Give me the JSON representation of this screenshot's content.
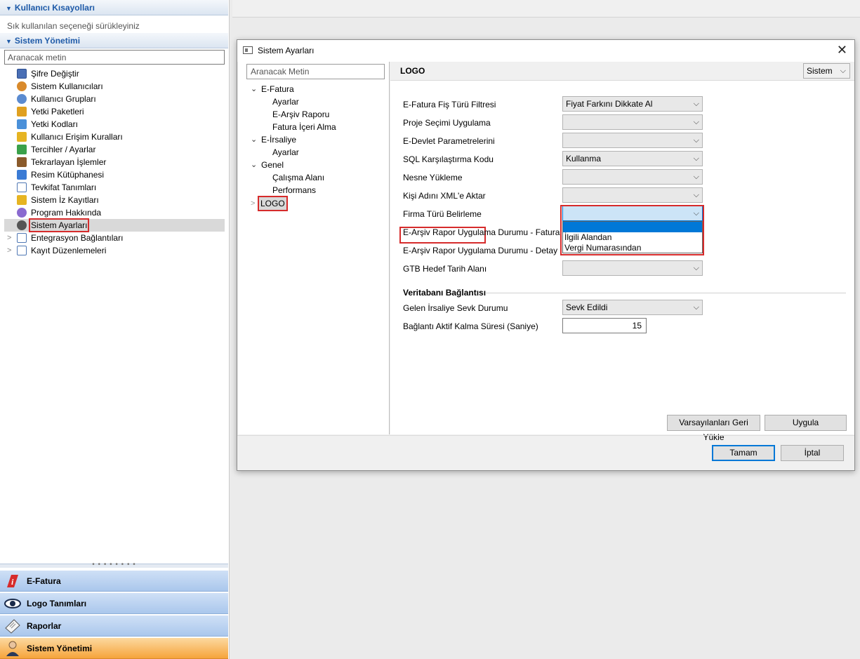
{
  "left_panel": {
    "shortcuts_header": "Kullanıcı Kısayolları",
    "shortcuts_hint": "Sık kullanılan seçeneği sürükleyiniz",
    "system_header": "Sistem Yönetimi",
    "search_placeholder": "Aranacak metin",
    "items": [
      {
        "label": "Şifre Değiştir",
        "icon": "password-icon",
        "color": "#4a6fb5"
      },
      {
        "label": "Sistem Kullanıcıları",
        "icon": "users-icon",
        "color": "#d98a2b"
      },
      {
        "label": "Kullanıcı Grupları",
        "icon": "user-groups-icon",
        "color": "#5b8bd0"
      },
      {
        "label": "Yetki Paketleri",
        "icon": "key-icon",
        "color": "#e0a020"
      },
      {
        "label": "Yetki Kodları",
        "icon": "key-icon",
        "color": "#4a90d9"
      },
      {
        "label": "Kullanıcı Erişim Kuralları",
        "icon": "lock-icon",
        "color": "#e6b422"
      },
      {
        "label": "Tercihler / Ayarlar",
        "icon": "preferences-icon",
        "color": "#3aa14a"
      },
      {
        "label": "Tekrarlayan İşlemler",
        "icon": "recurring-icon",
        "color": "#8a5a2b"
      },
      {
        "label": "Resim Kütüphanesi",
        "icon": "image-library-icon",
        "color": "#3a7bd5"
      },
      {
        "label": "Tevkifat Tanımları",
        "icon": "list-icon",
        "color": "#5078b4"
      },
      {
        "label": "Sistem İz Kayıtları",
        "icon": "warning-icon",
        "color": "#e6b422"
      },
      {
        "label": "Program Hakkında",
        "icon": "music-note-icon",
        "color": "#8a6ad0"
      },
      {
        "label": "Sistem Ayarları",
        "icon": "gear-icon",
        "color": "#555555"
      },
      {
        "label": "Entegrasyon Bağlantıları",
        "icon": "connections-icon",
        "color": "#5078b4"
      },
      {
        "label": "Kayıt Düzenlemeleri",
        "icon": "records-icon",
        "color": "#5078b4"
      }
    ],
    "bottom_buttons": [
      {
        "label": "E-Fatura",
        "icon": "e-fatura-icon"
      },
      {
        "label": "Logo Tanımları",
        "icon": "eye-icon"
      },
      {
        "label": "Raporlar",
        "icon": "report-icon"
      },
      {
        "label": "Sistem Yönetimi",
        "icon": "admin-user-icon"
      }
    ]
  },
  "dialog": {
    "title": "Sistem Ayarları",
    "tree_search_placeholder": "Aranacak Metin",
    "tree": {
      "efatura": "E-Fatura",
      "efatura_ayarlar": "Ayarlar",
      "earsiv_raporu": "E-Arşiv Raporu",
      "fatura_iceri_alma": "Fatura İçeri Alma",
      "eirsaliye": "E-İrsaliye",
      "eirsaliye_ayarlar": "Ayarlar",
      "genel": "Genel",
      "calisma_alani": "Çalışma Alanı",
      "performans": "Performans",
      "logo": "LOGO"
    },
    "content_title": "LOGO",
    "scope_value": "Sistem",
    "settings": [
      {
        "label": "E-Fatura Fiş Türü Filtresi",
        "value": "Fiyat Farkını Dikkate Al"
      },
      {
        "label": "Proje Seçimi Uygulama",
        "value": ""
      },
      {
        "label": "E-Devlet Parametrelerini",
        "value": ""
      },
      {
        "label": "SQL Karşılaştırma Kodu",
        "value": "Kullanma"
      },
      {
        "label": "Nesne Yükleme",
        "value": ""
      },
      {
        "label": "Kişi Adını XML'e Aktar",
        "value": ""
      },
      {
        "label": "Firma Türü Belirleme",
        "value": ""
      },
      {
        "label": "E-Arşiv Rapor Uygulama Durumu - Fatura",
        "value": ""
      },
      {
        "label": "E-Arşiv Rapor Uygulama Durumu - Detay",
        "value": ""
      },
      {
        "label": "GTB Hedef Tarih Alanı",
        "value": ""
      }
    ],
    "firma_dropdown_options": [
      "",
      "İlgili Alandan",
      "Vergi Numarasından"
    ],
    "db_group_title": "Veritabanı Bağlantısı",
    "db_settings": [
      {
        "label": "Gelen İrsaliye Sevk Durumu",
        "value": "Sevk Edildi"
      },
      {
        "label": "Bağlantı Aktif Kalma Süresi (Saniye)",
        "value": "15"
      }
    ],
    "buttons": {
      "defaults": "Varsayılanları Geri Yükle",
      "apply": "Uygula",
      "ok": "Tamam",
      "cancel": "İptal"
    }
  }
}
